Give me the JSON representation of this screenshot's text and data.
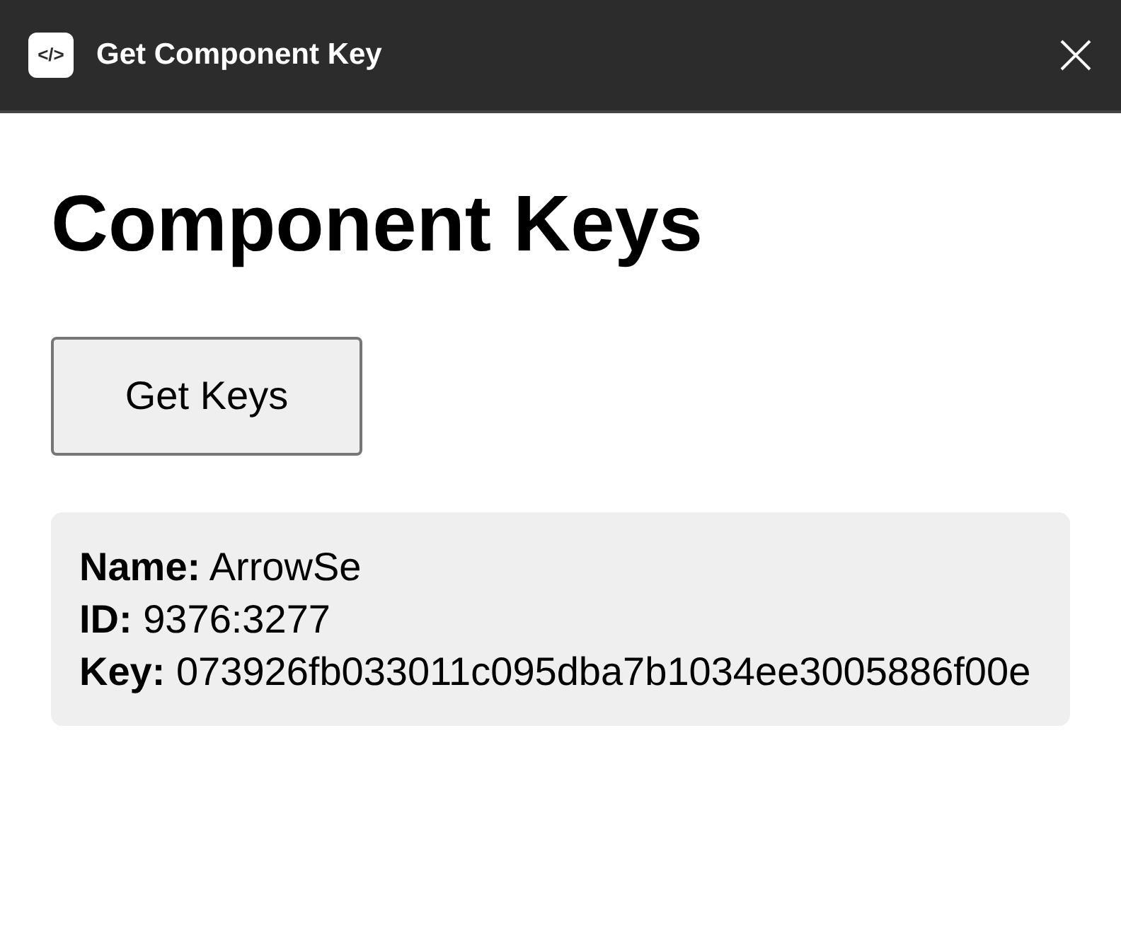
{
  "window": {
    "title": "Get Component Key",
    "icon_glyph": "</>"
  },
  "heading": "Component Keys",
  "button": "Get Keys",
  "result": {
    "lines": [
      "**Name:** ArrowSe",
      "**ID:** 9376:3277",
      "**Key:** 073926fb033011c095dba7b1034ee3005886f00e"
    ]
  }
}
